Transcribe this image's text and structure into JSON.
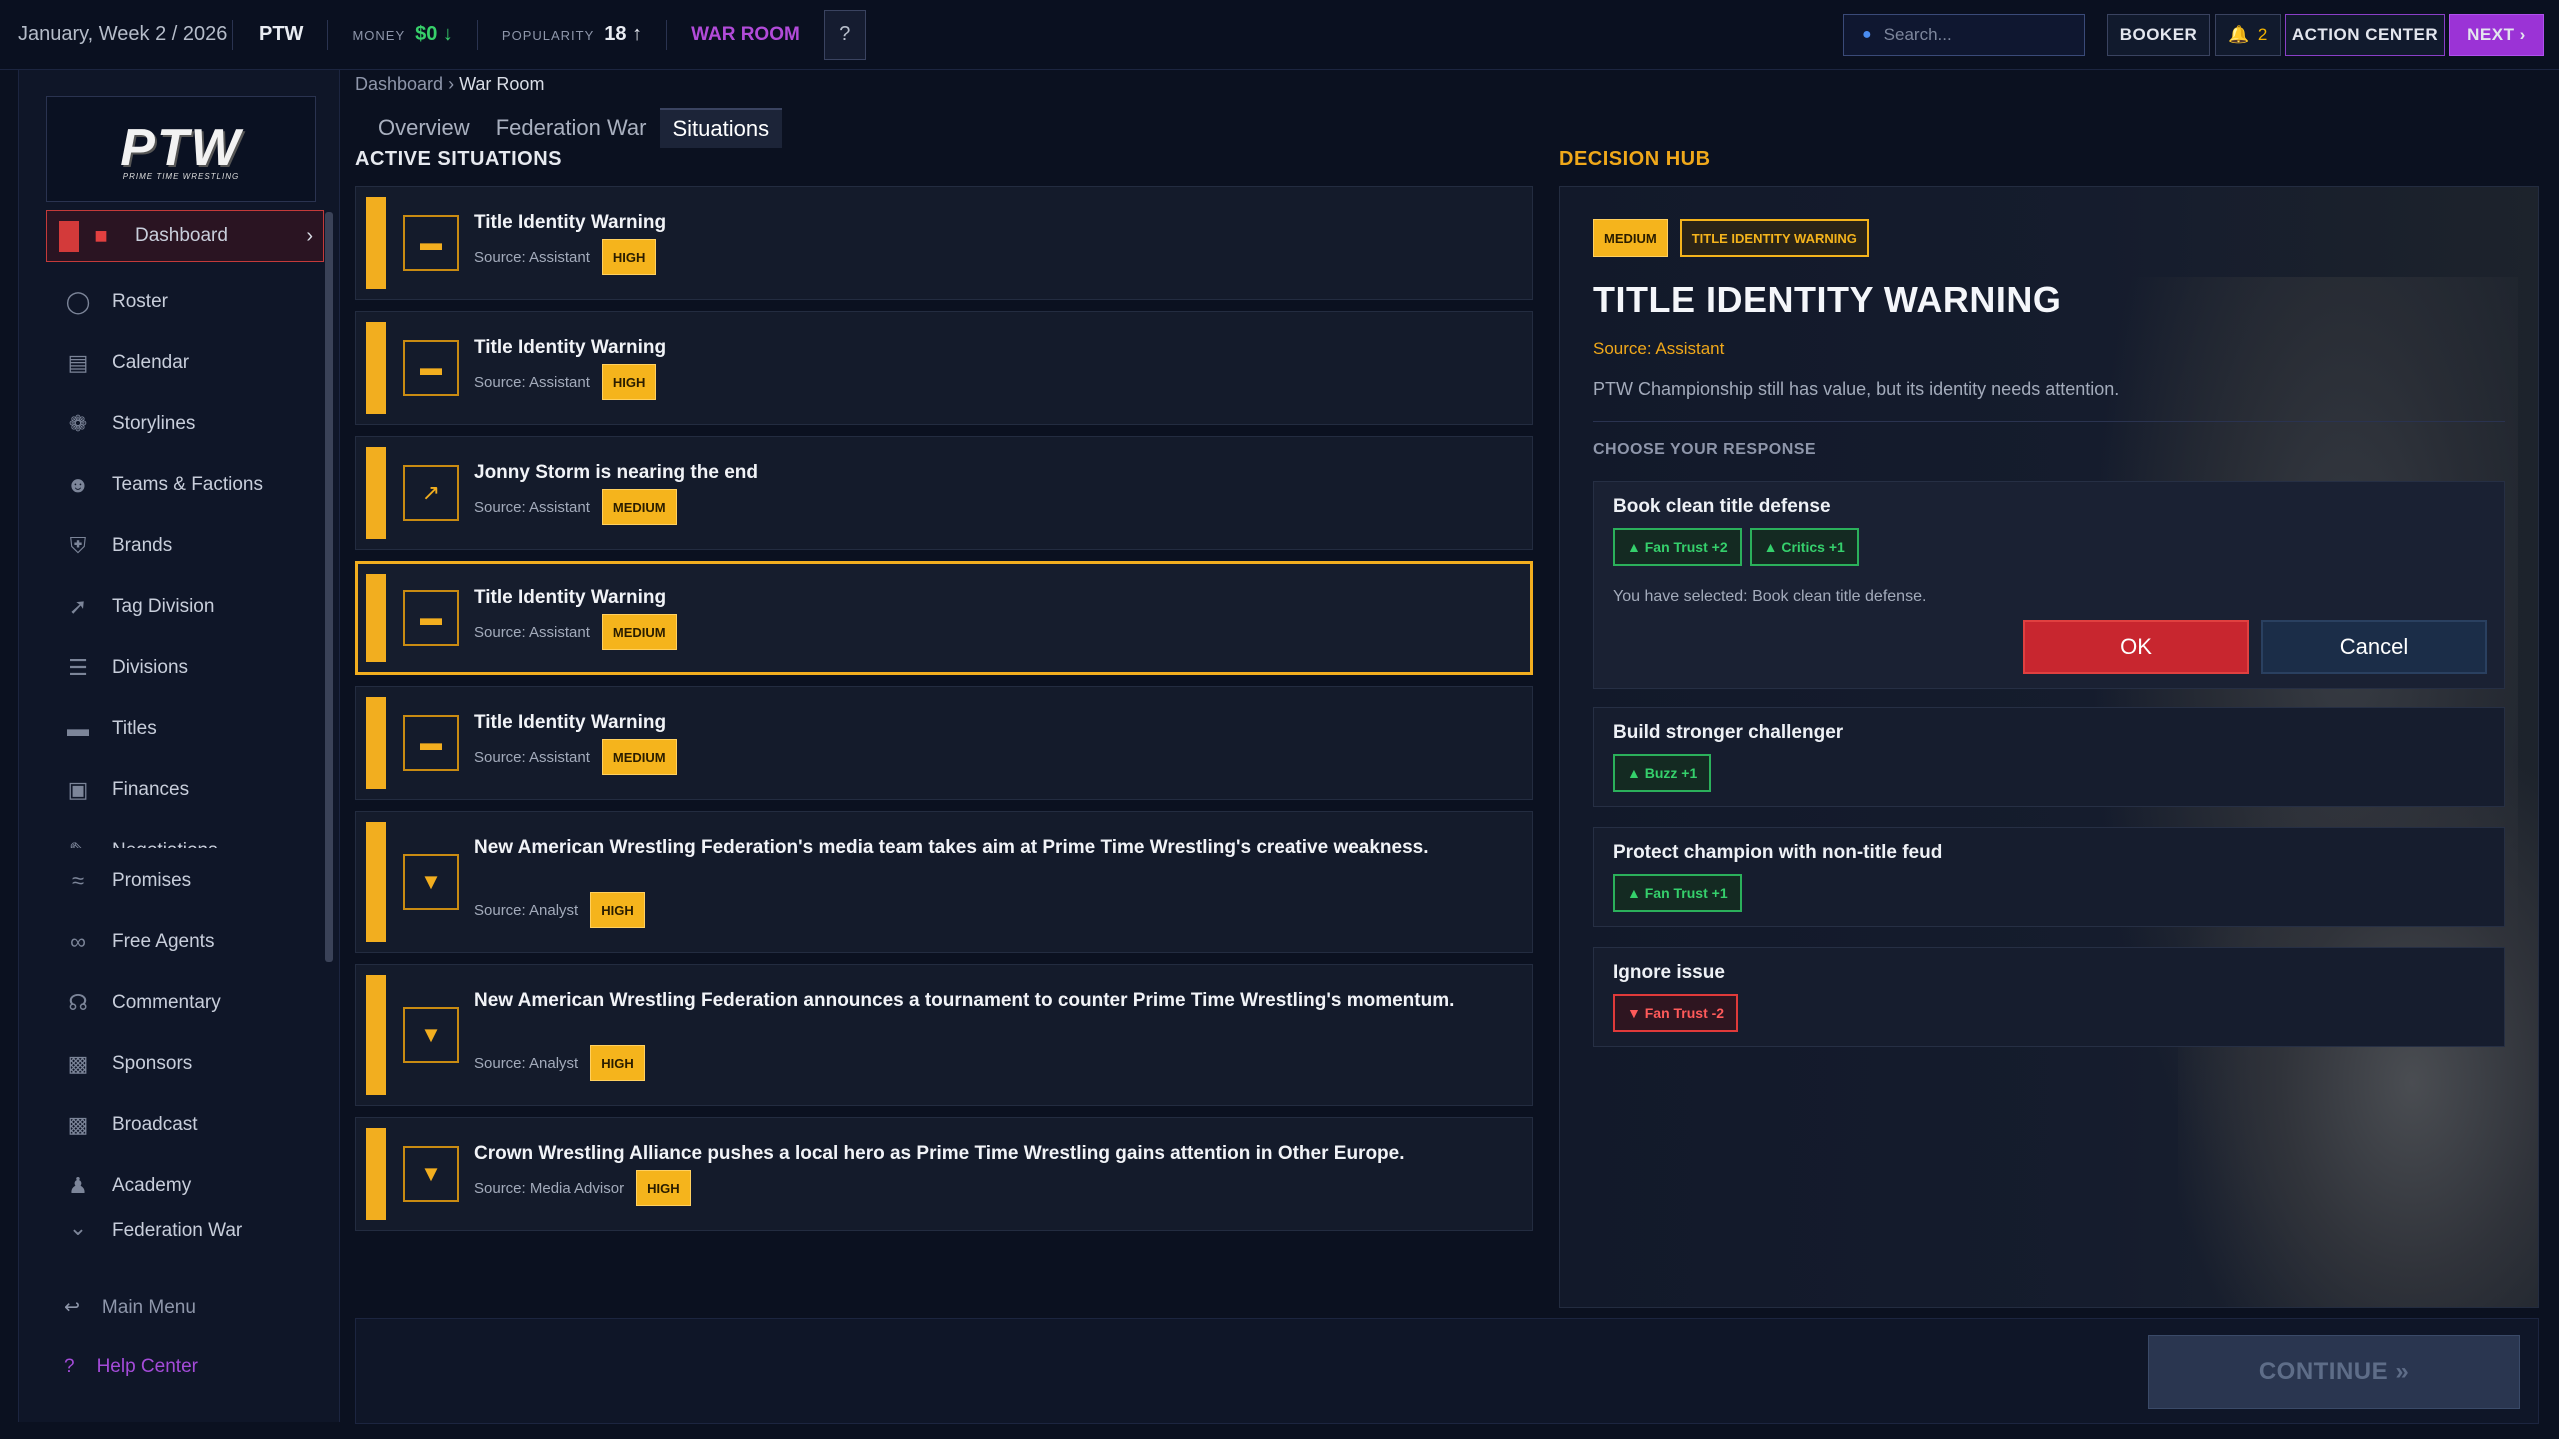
{
  "topbar": {
    "date": "January, Week 2 / 2026",
    "company": "PTW",
    "money_label": "MONEY",
    "money_value": "$0 ↓",
    "popularity_label": "POPULARITY",
    "popularity_value": "18 ↑",
    "war_room": "WAR ROOM",
    "help": "?",
    "search_placeholder": "Search...",
    "booker": "BOOKER",
    "notif_count": "2",
    "action_center": "ACTION CENTER",
    "next": "NEXT ›"
  },
  "sidebar": {
    "logo": "PTW",
    "logo_sub": "PRIME TIME WRESTLING",
    "items": [
      {
        "label": "Dashboard",
        "icon": "dashboard-icon"
      },
      {
        "label": "Roster",
        "icon": "roster-icon"
      },
      {
        "label": "Calendar",
        "icon": "calendar-icon"
      },
      {
        "label": "Storylines",
        "icon": "storylines-icon"
      },
      {
        "label": "Teams & Factions",
        "icon": "teams-icon"
      },
      {
        "label": "Brands",
        "icon": "shield-icon"
      },
      {
        "label": "Tag Division",
        "icon": "tag-icon"
      },
      {
        "label": "Divisions",
        "icon": "ladder-icon"
      },
      {
        "label": "Titles",
        "icon": "belt-icon"
      },
      {
        "label": "Finances",
        "icon": "money-icon"
      },
      {
        "label": "Negotiations",
        "icon": "contract-icon"
      },
      {
        "label": "Promises",
        "icon": "handshake-icon"
      },
      {
        "label": "Free Agents",
        "icon": "free-agent-icon"
      },
      {
        "label": "Commentary",
        "icon": "headset-icon"
      },
      {
        "label": "Sponsors",
        "icon": "briefcase-icon"
      },
      {
        "label": "Broadcast",
        "icon": "broadcast-icon"
      },
      {
        "label": "Academy",
        "icon": "academy-icon"
      },
      {
        "label": "Federation War",
        "icon": "chevron-icon"
      }
    ],
    "main_menu": "Main Menu",
    "help_center": "Help Center"
  },
  "breadcrumb": {
    "root": "Dashboard",
    "sep": "›",
    "current": "War Room"
  },
  "tabs": [
    "Overview",
    "Federation War",
    "Situations"
  ],
  "active_title": "ACTIVE SITUATIONS",
  "hub_title_label": "DECISION HUB",
  "situations": [
    {
      "title": "Title Identity Warning",
      "source": "Source: Assistant",
      "priority": "HIGH"
    },
    {
      "title": "Title Identity Warning",
      "source": "Source: Assistant",
      "priority": "HIGH"
    },
    {
      "title": "Jonny Storm is nearing the end",
      "source": "Source: Assistant",
      "priority": "MEDIUM"
    },
    {
      "title": "Title Identity Warning",
      "source": "Source: Assistant",
      "priority": "MEDIUM"
    },
    {
      "title": "Title Identity Warning",
      "source": "Source: Assistant",
      "priority": "MEDIUM"
    },
    {
      "title": "New American Wrestling Federation's media team takes aim at Prime Time Wrestling's creative weakness.",
      "source": "Source: Analyst",
      "priority": "HIGH"
    },
    {
      "title": "New American Wrestling Federation announces a tournament to counter Prime Time Wrestling's momentum.",
      "source": "Source: Analyst",
      "priority": "HIGH"
    },
    {
      "title": "Crown Wrestling Alliance pushes a local hero as Prime Time Wrestling gains attention in Other Europe.",
      "source": "Source: Media Advisor",
      "priority": "HIGH"
    }
  ],
  "hub": {
    "priority": "MEDIUM",
    "type": "TITLE IDENTITY WARNING",
    "title": "TITLE IDENTITY WARNING",
    "source": "Source: Assistant",
    "description": "PTW Championship still has value, but its identity needs attention.",
    "choose": "CHOOSE YOUR RESPONSE",
    "responses": [
      {
        "title": "Book clean title defense",
        "chips": [
          "▲ Fan Trust +2",
          "▲ Critics +1"
        ],
        "selected_text": "You have selected: Book clean title defense.",
        "ok": "OK",
        "cancel": "Cancel"
      },
      {
        "title": "Build stronger challenger",
        "chips": [
          "▲ Buzz +1"
        ]
      },
      {
        "title": "Protect champion with non-title feud",
        "chips": [
          "▲ Fan Trust +1"
        ]
      },
      {
        "title": "Ignore issue",
        "chips": [
          "▼ Fan Trust -2"
        ]
      }
    ]
  },
  "footer": {
    "continue": "CONTINUE »"
  },
  "colors": {
    "accent": "#f2ae1f",
    "purple": "#9b33d6",
    "danger": "#c8262f",
    "positive": "#35d06c"
  }
}
